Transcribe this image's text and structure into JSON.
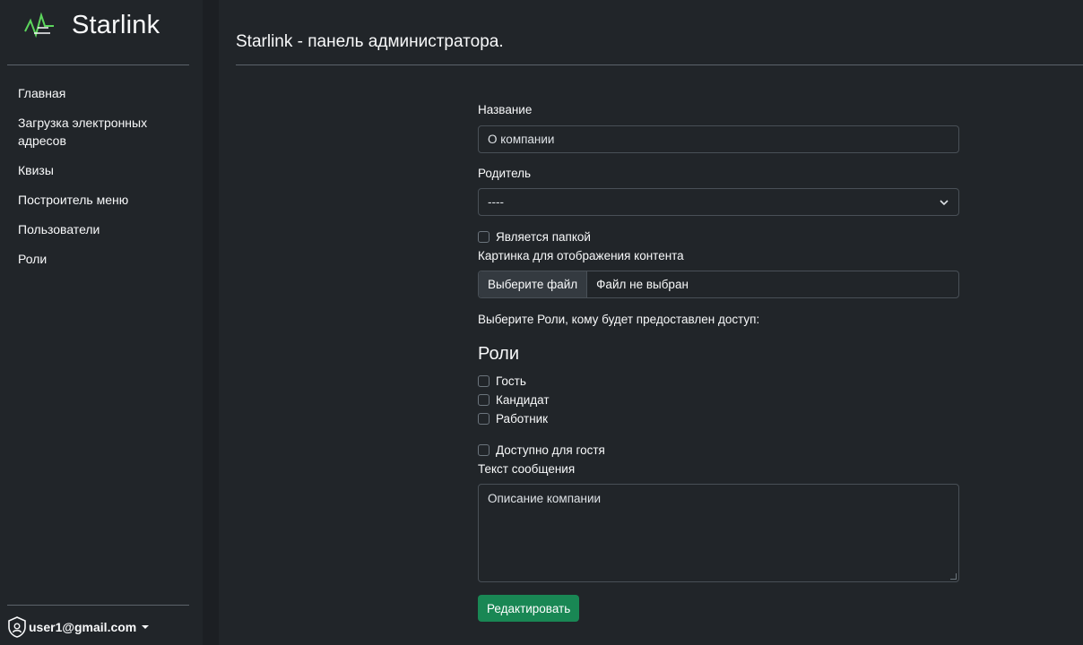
{
  "brand": {
    "name": "Starlink",
    "logo_icon": "starlink-logo",
    "accent": "#5cd65c"
  },
  "sidebar": {
    "items": [
      {
        "label": "Главная"
      },
      {
        "label": "Загрузка электронных адресов"
      },
      {
        "label": "Квизы"
      },
      {
        "label": "Построитель меню"
      },
      {
        "label": "Пользователи"
      },
      {
        "label": "Роли"
      }
    ],
    "user": {
      "email": "user1@gmail.com",
      "icon": "user-shield-icon"
    }
  },
  "header": {
    "title": "Starlink - панель администратора."
  },
  "form": {
    "name_label": "Название",
    "name_value": "О компании",
    "parent_label": "Родитель",
    "parent_value": "----",
    "is_folder_label": "Является папкой",
    "image_label": "Картинка для отображения контента",
    "file_button": "Выберите файл",
    "file_status": "Файл не выбран",
    "roles_prompt": "Выберите Роли, кому будет предоставлен доступ:",
    "roles_heading": "Роли",
    "roles": [
      {
        "label": "Гость"
      },
      {
        "label": "Кандидат"
      },
      {
        "label": "Работник"
      }
    ],
    "guest_access_label": "Доступно для гостя",
    "message_label": "Текст сообщения",
    "message_value": "Описание компании",
    "submit_label": "Редактировать"
  },
  "colors": {
    "background": "#212529",
    "submit": "#198754",
    "border": "#495057"
  }
}
